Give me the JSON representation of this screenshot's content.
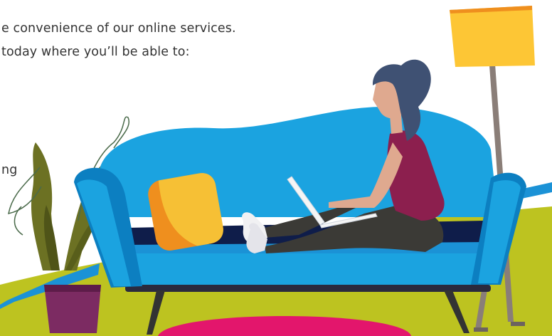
{
  "intro": {
    "line1": "e convenience of our online services.",
    "line2": "today where you’ll be able to:",
    "fragment": "ng"
  },
  "illustration": {
    "subject": "woman-on-sofa-with-laptop",
    "colors": {
      "sofa": "#1ba3e0",
      "sofa_dark": "#0c7fc1",
      "floor": "#bdc320",
      "cushion": "#f6c035",
      "cushion_shade": "#ef8f1e",
      "shirt": "#8c1f4e",
      "hair": "#3f5173",
      "rug": "#e3166c",
      "lamp_shade": "#fdc635",
      "plant": "#6c7123",
      "pot": "#7c2b62"
    }
  }
}
